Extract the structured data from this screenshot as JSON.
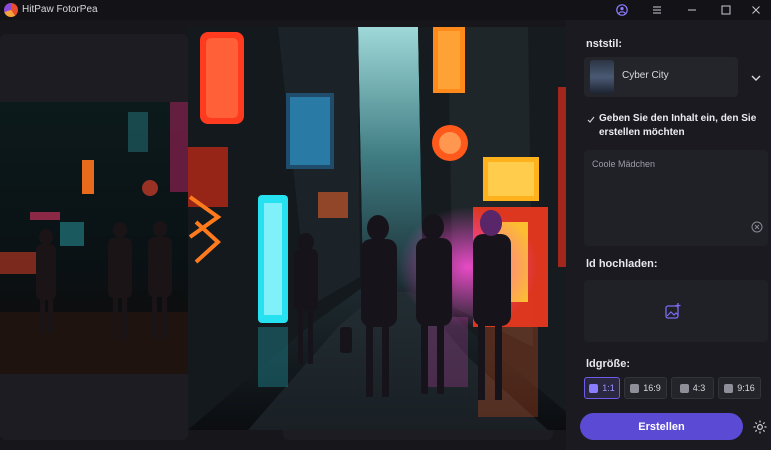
{
  "window": {
    "title": "HitPaw FotorPea",
    "icons": [
      "app-logo-icon",
      "account-icon",
      "menu-icon",
      "minimize-icon",
      "maximize-icon",
      "close-icon"
    ]
  },
  "panel": {
    "style_label": "nststil:",
    "style_value": "Cyber City",
    "prompt_heading": "Geben Sie den Inhalt ein, den Sie erstellen möchten",
    "prompt_value": "Coole Mädchen",
    "upload_label": "ld hochladen:",
    "size_label": "ldgröße:",
    "ratios": [
      {
        "label": "1:1",
        "active": true
      },
      {
        "label": "16:9",
        "active": false
      },
      {
        "label": "4:3",
        "active": false
      },
      {
        "label": "9:16",
        "active": false
      }
    ],
    "create_label": "Erstellen"
  },
  "colors": {
    "accent": "#5b4bd4",
    "neon_red": "#ff3b1f",
    "neon_cyan": "#36d6e6",
    "neon_orange": "#ff8a1c",
    "neon_magenta": "#e83ecb"
  }
}
